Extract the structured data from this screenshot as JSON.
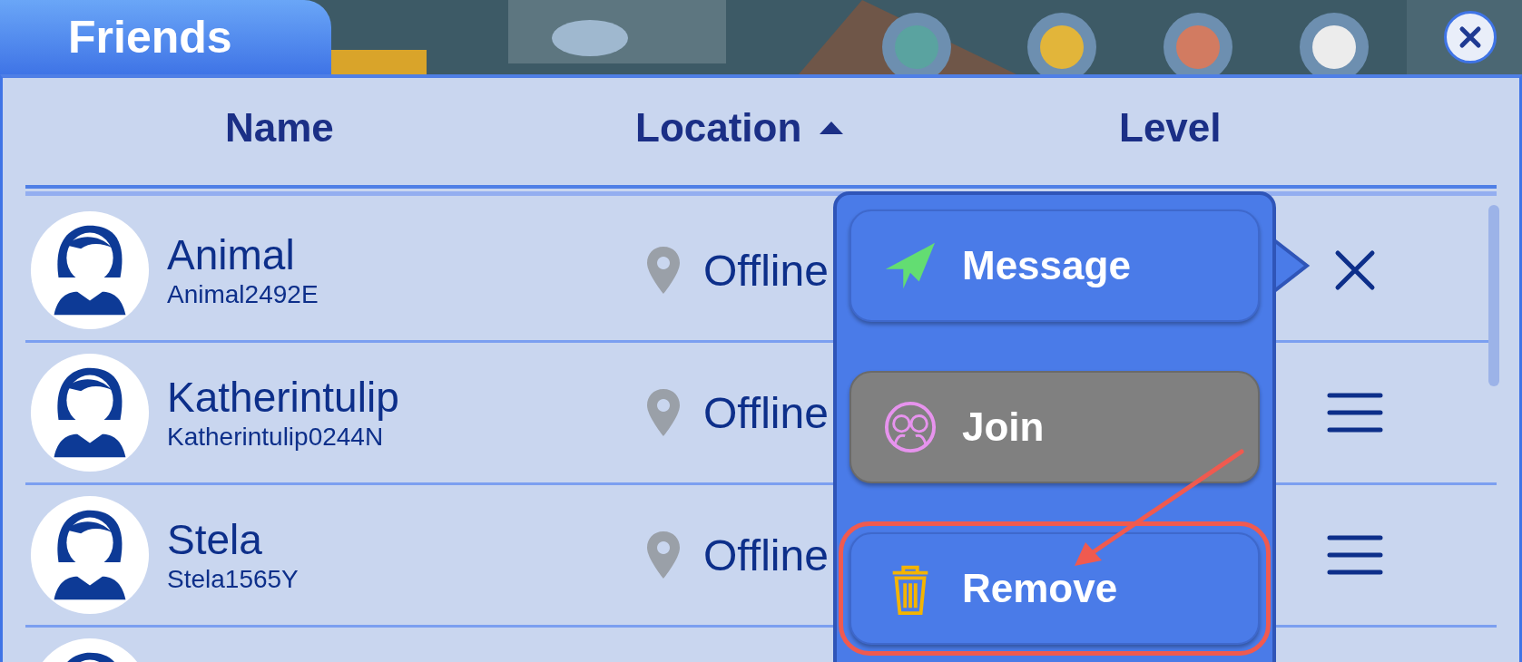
{
  "window": {
    "title": "Friends"
  },
  "columns": [
    {
      "label": "Name",
      "sorted": false
    },
    {
      "label": "Location",
      "sorted": true
    },
    {
      "label": "Level",
      "sorted": false
    }
  ],
  "friends": [
    {
      "kind": "friend",
      "name": "Animal",
      "username": "Animal2492E",
      "location": "Offline",
      "menu_open": true
    },
    {
      "kind": "friend",
      "name": "Katherintulip",
      "username": "Katherintulip0244N",
      "location": "Offline",
      "menu_open": false
    },
    {
      "kind": "friend",
      "name": "Stela",
      "username": "Stela1565Y",
      "location": "Offline",
      "menu_open": false
    },
    {
      "kind": "partial"
    }
  ],
  "menu": {
    "items": [
      {
        "label": "Message",
        "kind": "message",
        "disabled": false,
        "highlighted": false
      },
      {
        "label": "Join",
        "kind": "join",
        "disabled": true,
        "highlighted": false
      },
      {
        "label": "Remove",
        "kind": "remove",
        "disabled": false,
        "highlighted": true
      }
    ]
  }
}
